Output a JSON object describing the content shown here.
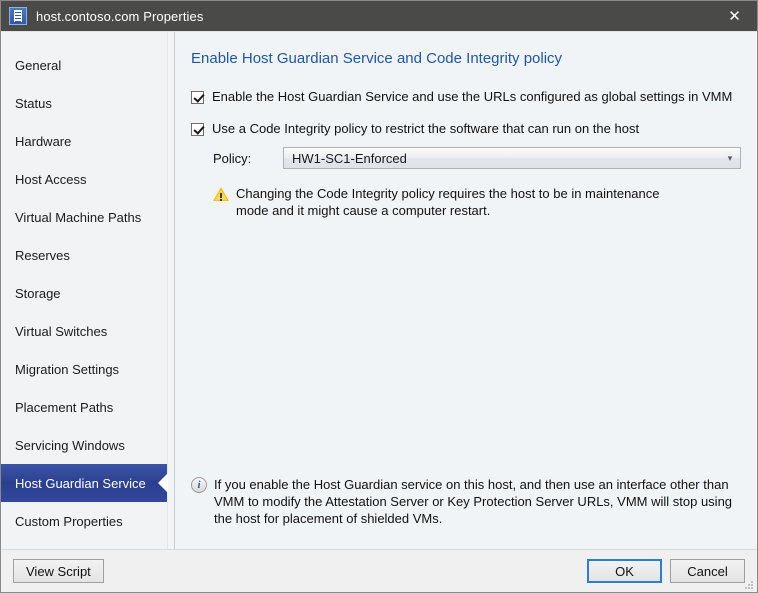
{
  "window": {
    "title": "host.contoso.com Properties",
    "icon": "host-server-icon",
    "close_label": "✕",
    "accent_blue": "#1f56a5",
    "selected_nav_blue": "#2b3f8f",
    "titlebar_bg": "#4a4a48"
  },
  "sidebar": {
    "items": [
      {
        "label": "General",
        "selected": false
      },
      {
        "label": "Status",
        "selected": false
      },
      {
        "label": "Hardware",
        "selected": false
      },
      {
        "label": "Host Access",
        "selected": false
      },
      {
        "label": "Virtual Machine Paths",
        "selected": false
      },
      {
        "label": "Reserves",
        "selected": false
      },
      {
        "label": "Storage",
        "selected": false
      },
      {
        "label": "Virtual Switches",
        "selected": false
      },
      {
        "label": "Migration Settings",
        "selected": false
      },
      {
        "label": "Placement Paths",
        "selected": false
      },
      {
        "label": "Servicing Windows",
        "selected": false
      },
      {
        "label": "Host Guardian Service",
        "selected": true
      },
      {
        "label": "Custom Properties",
        "selected": false
      }
    ]
  },
  "content": {
    "heading": "Enable Host Guardian Service and Code Integrity policy",
    "checkbox_hgs": {
      "label": "Enable the Host Guardian Service and use the URLs configured as global settings in VMM",
      "checked": true
    },
    "checkbox_ci": {
      "label": "Use a Code Integrity policy to restrict the software that can run on the host",
      "checked": true
    },
    "policy": {
      "label": "Policy:",
      "value": "HW1-SC1-Enforced",
      "arrow": "▾"
    },
    "warning": {
      "icon": "warning-triangle-icon",
      "text": "Changing the Code Integrity policy requires the host to be in maintenance mode and it might cause a computer restart."
    },
    "info": {
      "icon": "info-circle-icon",
      "glyph": "i",
      "text": "If you enable the Host Guardian service on this host, and then use an interface other than VMM to modify the Attestation Server or Key Protection Server URLs, VMM will stop using the host for placement of shielded VMs."
    }
  },
  "footer": {
    "view_script_label": "View Script",
    "ok_label": "OK",
    "cancel_label": "Cancel"
  }
}
